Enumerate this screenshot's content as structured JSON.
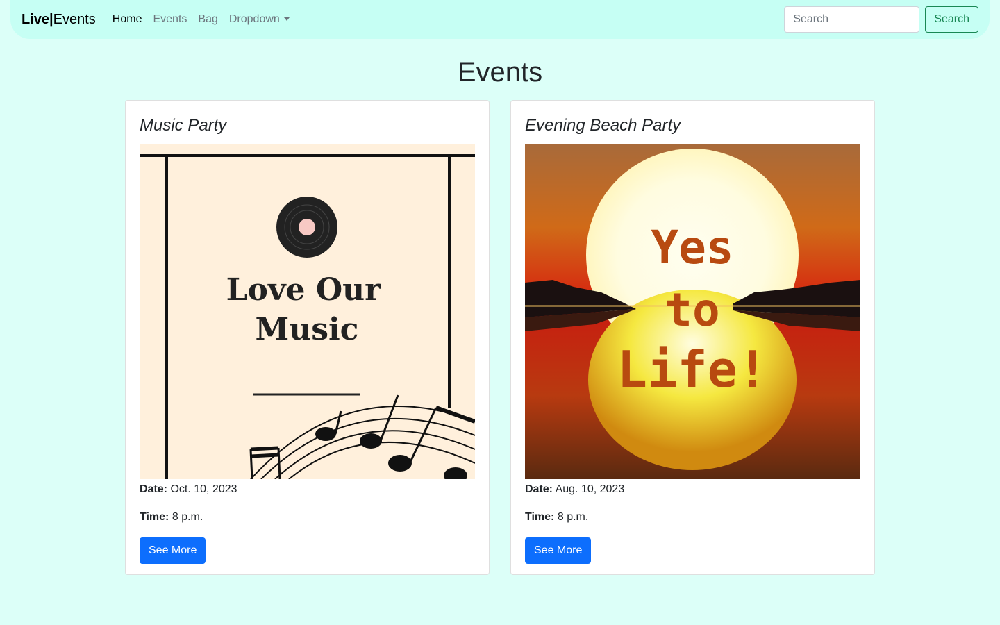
{
  "nav": {
    "brand_bold": "Live|",
    "brand_rest": "Events",
    "links": [
      "Home",
      "Events",
      "Bag",
      "Dropdown"
    ],
    "search_placeholder": "Search",
    "search_button": "Search"
  },
  "page": {
    "title": "Events"
  },
  "cards": [
    {
      "title": "Music Party",
      "image_text": [
        "Love Our",
        "Music"
      ],
      "date_label": "Date:",
      "date": "Oct. 10, 2023",
      "time_label": "Time:",
      "time": "8 p.m.",
      "button": "See More"
    },
    {
      "title": "Evening Beach Party",
      "image_text": [
        "Yes",
        "to",
        "Life!"
      ],
      "date_label": "Date:",
      "date": "Aug. 10, 2023",
      "time_label": "Time:",
      "time": "8 p.m.",
      "button": "See More"
    }
  ],
  "colors": {
    "background": "#dcfff8",
    "navbar": "#c6fff4",
    "primary": "#0d6efd",
    "success": "#198754"
  }
}
